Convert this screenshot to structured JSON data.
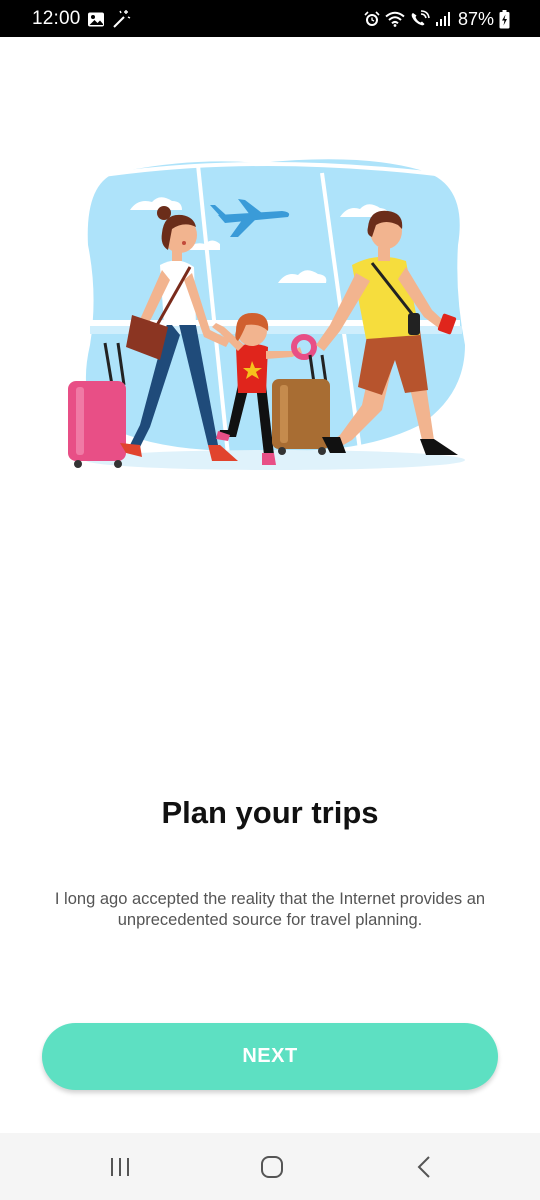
{
  "status_bar": {
    "time": "12:00",
    "battery_percent": "87%",
    "left_icons": [
      "image-icon",
      "magic-wand-icon"
    ],
    "right_icons": [
      "alarm-icon",
      "wifi-icon",
      "wifi-calling-icon",
      "signal-icon",
      "battery-charging-icon"
    ]
  },
  "onboarding": {
    "illustration": "family-travel-illustration",
    "title": "Plan your trips",
    "description": "I long ago accepted the reality that the Internet provides an unprecedented source for travel planning.",
    "next_label": "NEXT"
  },
  "nav_bar": {
    "buttons": [
      "recent-apps-icon",
      "home-icon",
      "back-icon"
    ]
  },
  "colors": {
    "accent": "#5de0c2",
    "sky": "#aee3fa",
    "title": "#111111",
    "body_text": "#555555"
  }
}
